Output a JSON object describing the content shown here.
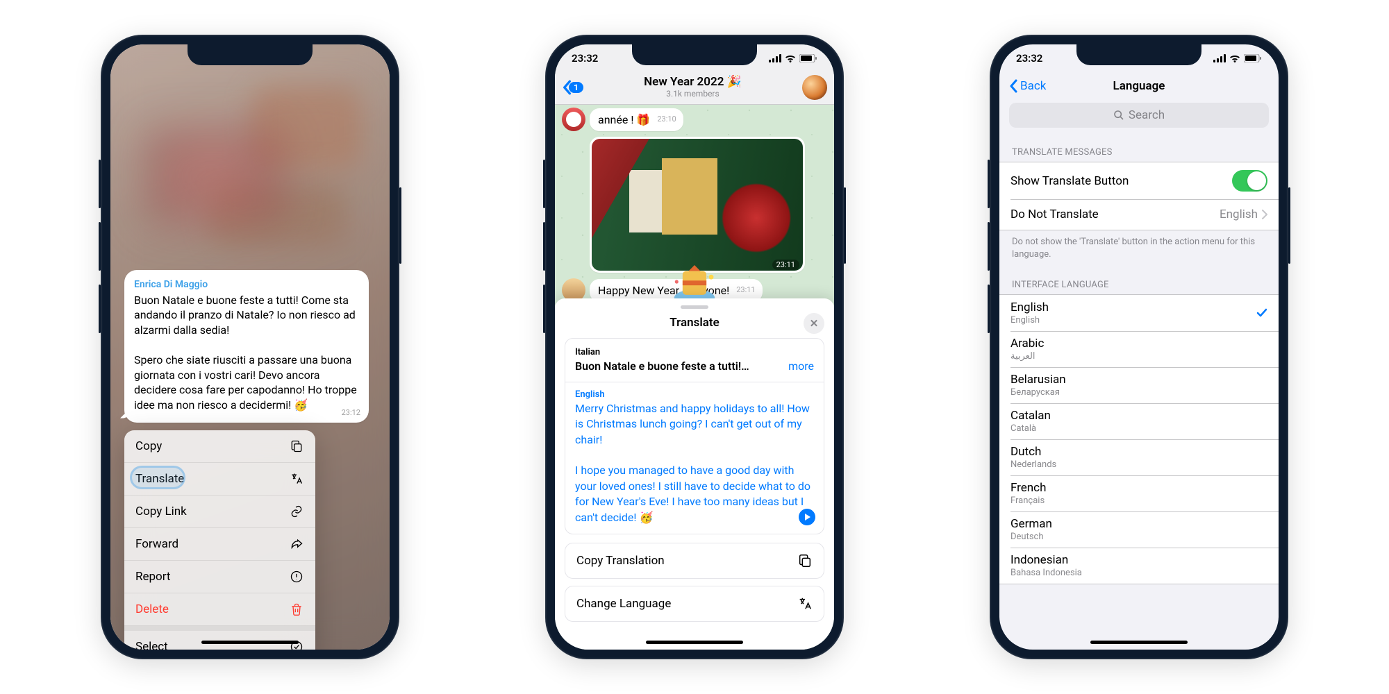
{
  "status": {
    "time": "23:32"
  },
  "phone1": {
    "bubble": {
      "sender": "Enrica Di Maggio",
      "text": "Buon Natale e buone feste a tutti! Come sta andando il pranzo di Natale? Io non riesco ad alzarmi dalla sedia!\n\nSpero che siate riusciti a passare una buona giornata con i vostri cari! Devo ancora decidere cosa fare per capodanno! Ho troppe idee ma non riesco a decidermi! 🥳",
      "time": "23:12"
    },
    "menu": {
      "copy": "Copy",
      "translate": "Translate",
      "copy_link": "Copy Link",
      "forward": "Forward",
      "report": "Report",
      "delete": "Delete",
      "select": "Select"
    }
  },
  "phone2": {
    "header": {
      "back_badge": "1",
      "title": "New Year 2022 🎉",
      "subtitle": "3.1k members"
    },
    "msg1": {
      "text": "année ! 🎁",
      "time": "23:10"
    },
    "msg2": {
      "time": "23:11"
    },
    "msg3": {
      "text": "Happy New Year everyone!",
      "time": "23:11"
    },
    "sheet": {
      "title": "Translate",
      "src_lang": "Italian",
      "src_text": "Buon Natale e buone feste a tutti!…",
      "more": "more",
      "dst_lang": "English",
      "dst_text": "Merry Christmas and happy holidays to all! How is Christmas lunch going? I can't get out of my chair!\n\nI hope you managed to have a good day with your loved ones! I still have to decide what to do for New Year's Eve! I have too many ideas but I can't decide! 🥳",
      "copy_translation": "Copy Translation",
      "change_language": "Change Language"
    }
  },
  "phone3": {
    "back": "Back",
    "title": "Language",
    "search_placeholder": "Search",
    "section_translate": "TRANSLATE MESSAGES",
    "show_translate": "Show Translate Button",
    "do_not_translate": "Do Not Translate",
    "do_not_translate_value": "English",
    "translate_footer": "Do not show the 'Translate' button in the action menu for this language.",
    "section_interface": "INTERFACE LANGUAGE",
    "languages": [
      {
        "name": "English",
        "native": "English",
        "selected": true
      },
      {
        "name": "Arabic",
        "native": "العربية",
        "selected": false
      },
      {
        "name": "Belarusian",
        "native": "Беларуская",
        "selected": false
      },
      {
        "name": "Catalan",
        "native": "Català",
        "selected": false
      },
      {
        "name": "Dutch",
        "native": "Nederlands",
        "selected": false
      },
      {
        "name": "French",
        "native": "Français",
        "selected": false
      },
      {
        "name": "German",
        "native": "Deutsch",
        "selected": false
      },
      {
        "name": "Indonesian",
        "native": "Bahasa Indonesia",
        "selected": false
      }
    ]
  }
}
